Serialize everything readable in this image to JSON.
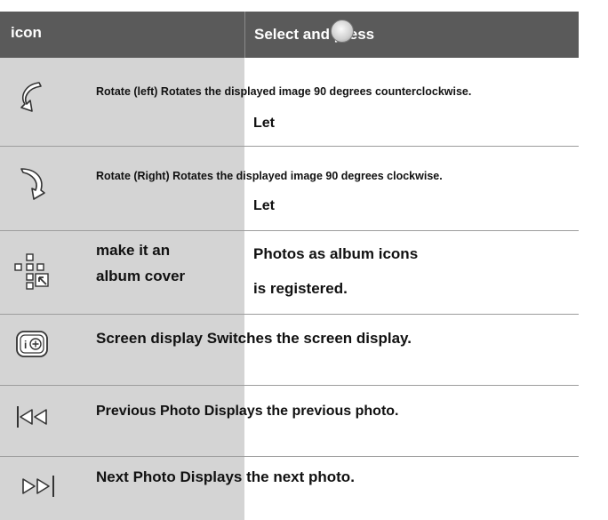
{
  "header": {
    "col1": "icon",
    "col2": "Select and press"
  },
  "rows": [
    {
      "icon": "rotate-left-icon",
      "text": "Rotate (left) Rotates the displayed image 90 degrees counterclockwise.",
      "sub": "Let"
    },
    {
      "icon": "rotate-right-icon",
      "text": "Rotate (Right) Rotates the displayed image 90 degrees clockwise.",
      "sub": "Let"
    },
    {
      "icon": "album-cover-icon",
      "name_line1": "make it an",
      "name_line2": "album cover",
      "desc_line1": "Photos as album icons",
      "desc_line2": "is registered."
    },
    {
      "icon": "info-plus-icon",
      "text": "Screen display Switches the screen display."
    },
    {
      "icon": "previous-icon",
      "text": "Previous Photo Displays the previous photo."
    },
    {
      "icon": "next-icon",
      "text": "Next Photo Displays the next photo."
    }
  ]
}
